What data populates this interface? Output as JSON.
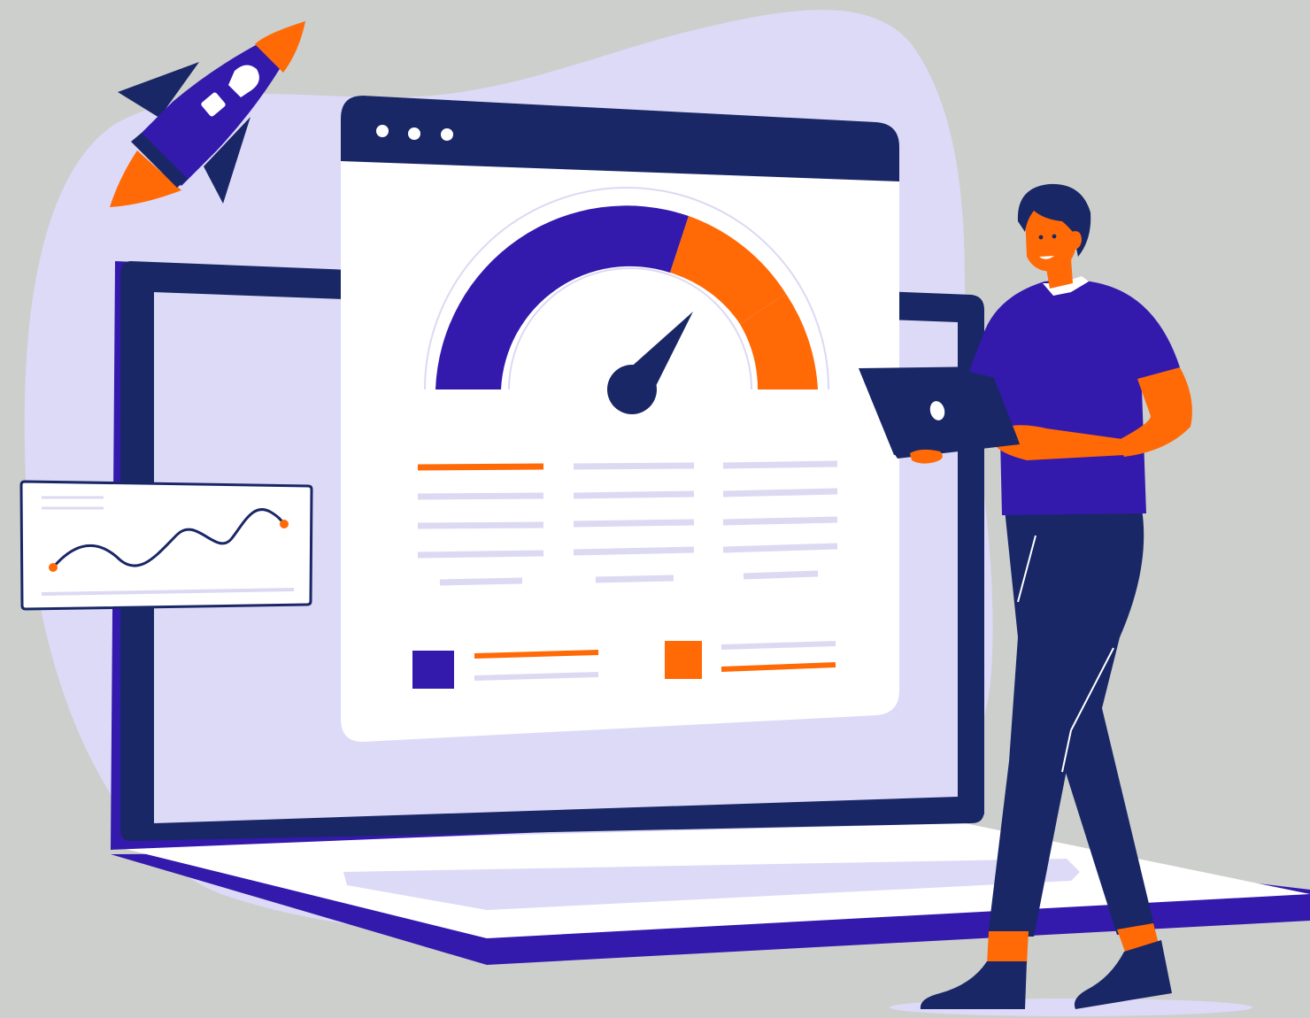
{
  "colors": {
    "background": "#cdcfcc",
    "blob": "#dcdaf7",
    "navy": "#1a2766",
    "purple": "#3419ad",
    "orange": "#ff6a07",
    "white": "#ffffff",
    "line_lavender": "#dcd9f3",
    "skin": "#ff6a07"
  },
  "icons": {
    "rocket": "rocket-icon",
    "gauge": "speedometer-icon",
    "sparkline": "wave-line-icon",
    "person": "person-with-laptop"
  },
  "gauge": {
    "segments": [
      "purple",
      "orange",
      "orange"
    ]
  }
}
